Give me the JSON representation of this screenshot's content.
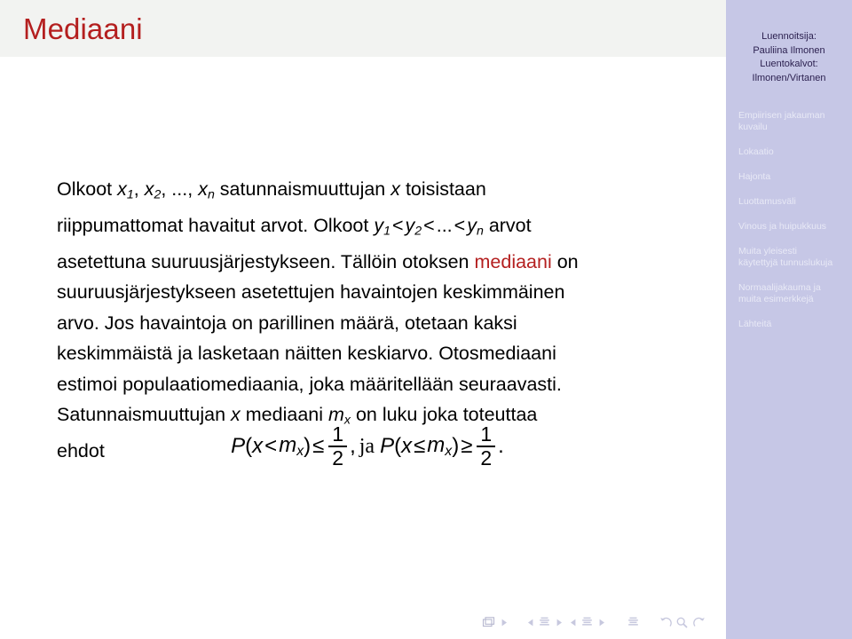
{
  "slide": {
    "title": "Mediaani"
  },
  "sidebar": {
    "header_lines": [
      "Luennoitsija:",
      "Pauliina Ilmonen",
      "Luentokalvot:",
      "Ilmonen/Virtanen"
    ],
    "nav_items": [
      {
        "line1": "Empiirisen jakauman",
        "line2": "kuvailu"
      },
      {
        "line1": "Lokaatio",
        "line2": ""
      },
      {
        "line1": "Hajonta",
        "line2": ""
      },
      {
        "line1": "Luottamusväli",
        "line2": ""
      },
      {
        "line1": "Vinous ja huipukkuus",
        "line2": ""
      },
      {
        "line1": "Muita yleisesti",
        "line2": "käytettyjä tunnuslukuja"
      },
      {
        "line1": "Normaalijakauma ja",
        "line2": "muita esimerkkejä"
      },
      {
        "line1": "Lähteitä",
        "line2": ""
      }
    ],
    "bg_color": "#c6c7e6",
    "header_text_color": "#2c2150",
    "nav_text_color": "#e8e9f6"
  },
  "body": {
    "line1_a": "Olkoot ",
    "line1_var1": "x",
    "line1_sub1": "1",
    "line1_sep1": ", ",
    "line1_var2": "x",
    "line1_sub2": "2",
    "line1_sep2": ", ..., ",
    "line1_var3": "x",
    "line1_sub3": "n",
    "line1_b": " satunnaismuuttujan ",
    "line1_varx": "x",
    "line1_c": " toisistaan",
    "line2_a": "riippumattomat havaitut arvot. Olkoot ",
    "line2_var1": "y",
    "line2_sub1": "1",
    "line2_rel1": "<",
    "line2_var2": "y",
    "line2_sub2": "2",
    "line2_rel2": "<",
    "line2_dots": "...",
    "line2_rel3": "<",
    "line2_var3": "y",
    "line2_sub3": "n",
    "line2_b": " arvot",
    "line3_a": "asetettuna suuruusjärjestykseen. Tällöin otoksen ",
    "line3_hl": "mediaani",
    "line3_b": " on",
    "line4": "suuruusjärjestykseen asetettujen havaintojen keskimmäinen",
    "line5": "arvo. Jos havaintoja on parillinen määrä, otetaan kaksi",
    "line6": "keskimmäistä ja lasketaan näitten keskiarvo. Otosmediaani",
    "line7": "estimoi populaatiomediaania, joka määritellään seuraavasti.",
    "line8_a": "Satunnaismuuttujan ",
    "line8_varx": "x",
    "line8_b": " mediaani ",
    "line8_varm": "m",
    "line8_subm": "x",
    "line8_c": " on luku joka toteuttaa",
    "line9": "ehdot",
    "highlight_color": "#b41f1f"
  },
  "formula": {
    "p1": "P",
    "open1": "(",
    "var_x1": "x",
    "rel_lt": "<",
    "var_m1": "m",
    "sub_m1": "x",
    "close1": ")",
    "rel_le1": "≤",
    "frac1_num": "1",
    "frac1_den": "2",
    "comma": ",",
    "ja": "ja",
    "p2": "P",
    "open2": "(",
    "var_x2": "x",
    "rel_le2": "≤",
    "var_m2": "m",
    "sub_m2": "x",
    "close2": ")",
    "rel_ge": "≥",
    "frac2_num": "1",
    "frac2_den": "2",
    "period": "."
  },
  "navbar": {
    "buttons": [
      {
        "name": "frames-icon",
        "label": "frames"
      },
      {
        "name": "next-frame-icon",
        "label": "next frame"
      },
      {
        "name": "prev-subsection-icon",
        "label": "previous subsection"
      },
      {
        "name": "subsection-icon",
        "label": "subsection"
      },
      {
        "name": "next-subsection-icon",
        "label": "next subsection"
      },
      {
        "name": "prev-section-icon",
        "label": "previous section"
      },
      {
        "name": "section-icon",
        "label": "section"
      },
      {
        "name": "next-section-icon",
        "label": "next section"
      },
      {
        "name": "presentation-icon",
        "label": "presentation"
      },
      {
        "name": "back-icon",
        "label": "back"
      },
      {
        "name": "find-icon",
        "label": "find"
      },
      {
        "name": "forward-icon",
        "label": "forward"
      }
    ]
  }
}
